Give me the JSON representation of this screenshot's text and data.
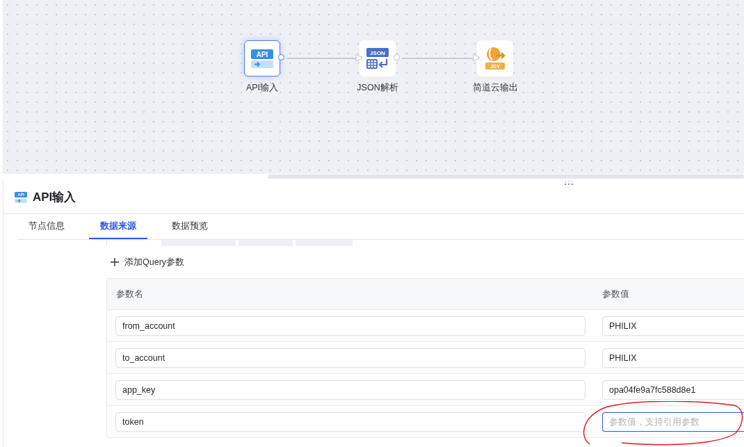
{
  "flow": {
    "nodes": [
      {
        "kind": "api",
        "badge": "API",
        "label": "API输入",
        "selected": true
      },
      {
        "kind": "json",
        "badge": "JSON",
        "label": "JSON解析",
        "selected": false
      },
      {
        "kind": "jdy",
        "badge": "JDY",
        "label": "简道云输出",
        "selected": false
      }
    ]
  },
  "panel": {
    "title": "API输入",
    "tabs": [
      {
        "label": "节点信息",
        "selected": false
      },
      {
        "label": "数据来源",
        "selected": true
      },
      {
        "label": "数据预览",
        "selected": false
      }
    ],
    "add_button": "添加Query参数",
    "table": {
      "columns": [
        "参数名",
        "参数值"
      ],
      "rows": [
        {
          "name": "from_account",
          "value": "PHILIX",
          "focused": false
        },
        {
          "name": "to_account",
          "value": "PHILIX",
          "focused": false
        },
        {
          "name": "app_key",
          "value": "opa04fe9a7fc588d8e1",
          "focused": false
        },
        {
          "name": "token",
          "placeholder": "参数值，支持引用参数",
          "focused": true
        }
      ]
    }
  }
}
